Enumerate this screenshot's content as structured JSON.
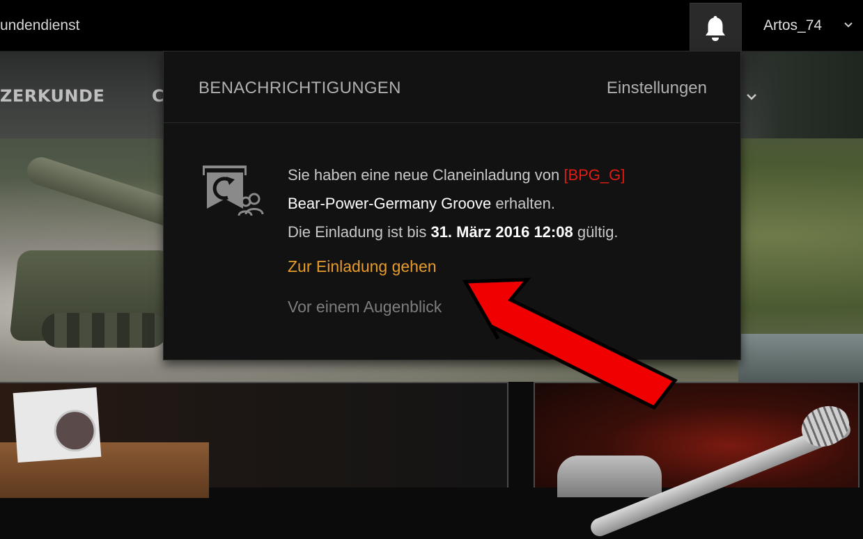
{
  "topbar": {
    "support_label": "undendienst",
    "bell_icon": "bell-icon",
    "username": "Artos_74",
    "user_chevron_icon": "chevron-down-icon"
  },
  "nav": {
    "items": [
      "ZERKUNDE",
      "C"
    ]
  },
  "notifications": {
    "title": "BENACHRICHTIGUNGEN",
    "settings_label": "Einstellungen",
    "item": {
      "icon": "clan-invite-icon",
      "text_intro": "Sie haben eine neue Claneinladung von ",
      "clan_tag": "[BPG_G]",
      "clan_name": "Bear-Power-Germany Groove",
      "text_received": " erhalten.",
      "validity_prefix": "Die Einladung ist bis ",
      "validity_date": "31. März 2016 12:08",
      "validity_suffix": " gültig.",
      "link_label": "Zur Einladung gehen",
      "timestamp": "Vor einem Augenblick"
    }
  },
  "colors": {
    "clan_tag": "#e21c12",
    "link": "#e79c2b",
    "annotation_arrow": "#f00000"
  },
  "annotation": {
    "icon": "red-arrow-icon"
  }
}
